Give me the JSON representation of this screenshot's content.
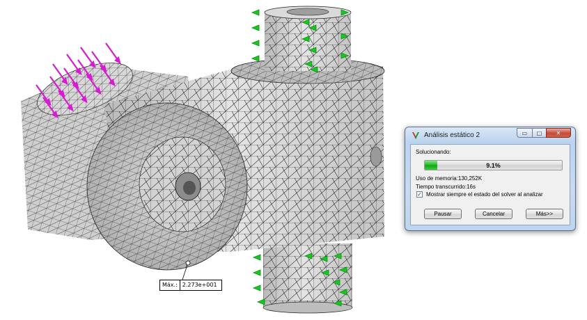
{
  "viewport": {
    "max_callout": {
      "label": "Máx.:",
      "value": "2.273e+001"
    },
    "colors": {
      "mesh_fill": "#d2d2d2",
      "mesh_lines": "#1a1a1a",
      "force_arrows": "#d61bd0",
      "fixture_arrows": "#16c81f"
    }
  },
  "dialog": {
    "title": "Análisis estático 2",
    "window_buttons": {
      "minimize": "▭",
      "maximize": "□",
      "close": "✕"
    },
    "status_label": "Solucionando:",
    "progress": {
      "value": 0.091,
      "text": "9.1%"
    },
    "memory": "Uso de memoria:130,252K",
    "elapsed": "Tiempo transcurrido:16s",
    "checkbox": {
      "checked": true,
      "label": "Mostrar siempre el estado del solver al analizar"
    },
    "buttons": {
      "pause": "Pausar",
      "cancel": "Cancelar",
      "more": "Más>>"
    }
  }
}
